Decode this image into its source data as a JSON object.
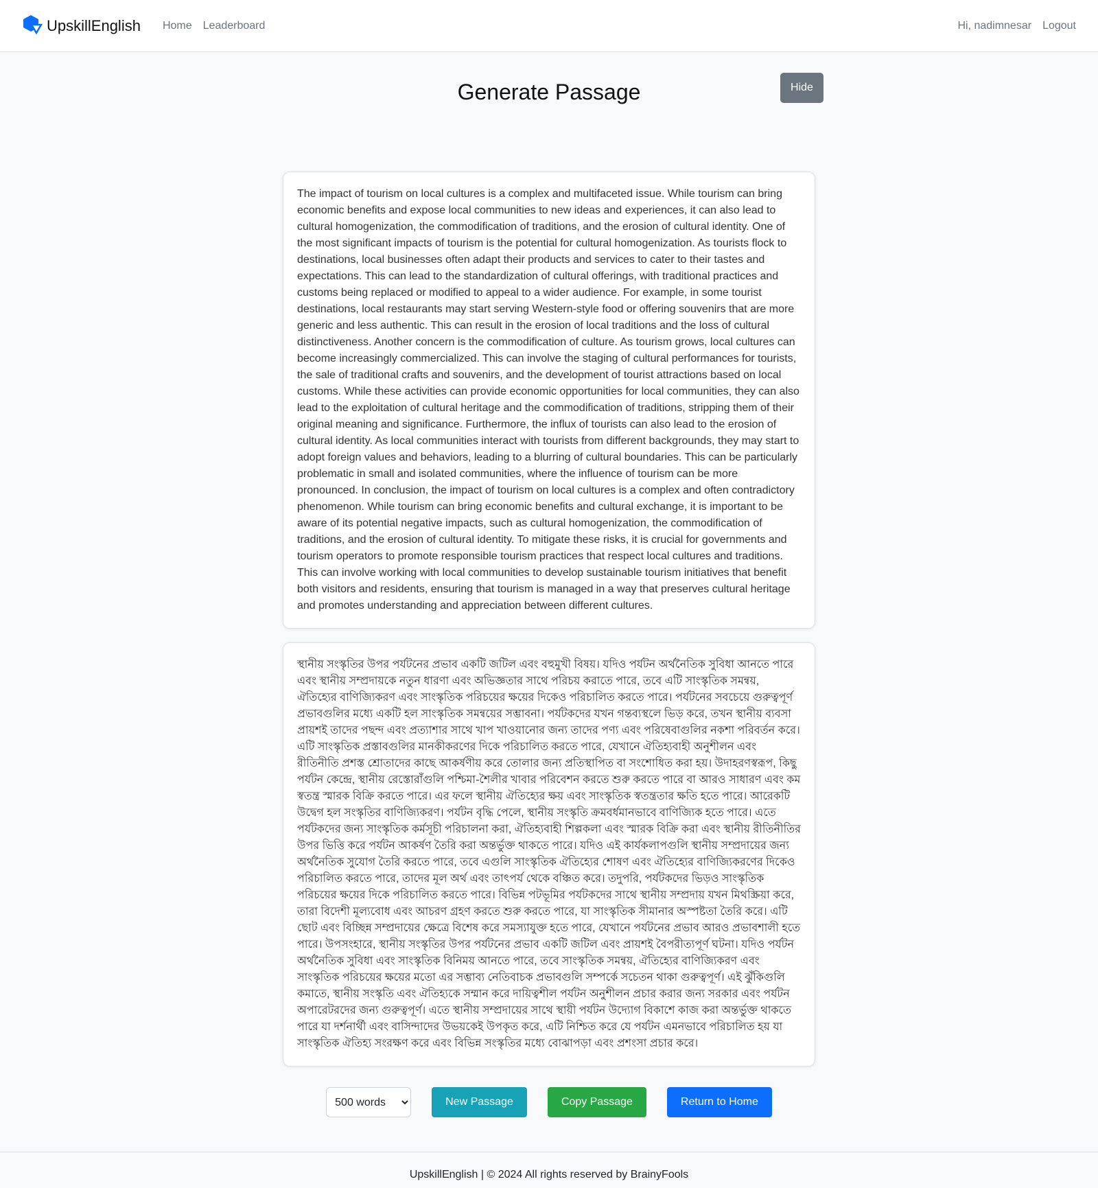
{
  "nav": {
    "brand": "UpskillEnglish",
    "links": [
      "Home",
      "Leaderboard"
    ],
    "greeting": "Hi, nadimnesar",
    "logout": "Logout"
  },
  "page": {
    "title": "Generate Passage",
    "hide_label": "Hide"
  },
  "passage": {
    "english": "The impact of tourism on local cultures is a complex and multifaceted issue. While tourism can bring economic benefits and expose local communities to new ideas and experiences, it can also lead to cultural homogenization, the commodification of traditions, and the erosion of cultural identity. One of the most significant impacts of tourism is the potential for cultural homogenization. As tourists flock to destinations, local businesses often adapt their products and services to cater to their tastes and expectations. This can lead to the standardization of cultural offerings, with traditional practices and customs being replaced or modified to appeal to a wider audience. For example, in some tourist destinations, local restaurants may start serving Western-style food or offering souvenirs that are more generic and less authentic. This can result in the erosion of local traditions and the loss of cultural distinctiveness. Another concern is the commodification of culture. As tourism grows, local cultures can become increasingly commercialized. This can involve the staging of cultural performances for tourists, the sale of traditional crafts and souvenirs, and the development of tourist attractions based on local customs. While these activities can provide economic opportunities for local communities, they can also lead to the exploitation of cultural heritage and the commodification of traditions, stripping them of their original meaning and significance. Furthermore, the influx of tourists can also lead to the erosion of cultural identity. As local communities interact with tourists from different backgrounds, they may start to adopt foreign values and behaviors, leading to a blurring of cultural boundaries. This can be particularly problematic in small and isolated communities, where the influence of tourism can be more pronounced. In conclusion, the impact of tourism on local cultures is a complex and often contradictory phenomenon. While tourism can bring economic benefits and cultural exchange, it is important to be aware of its potential negative impacts, such as cultural homogenization, the commodification of traditions, and the erosion of cultural identity. To mitigate these risks, it is crucial for governments and tourism operators to promote responsible tourism practices that respect local cultures and traditions. This can involve working with local communities to develop sustainable tourism initiatives that benefit both visitors and residents, ensuring that tourism is managed in a way that preserves cultural heritage and promotes understanding and appreciation between different cultures.",
    "bengali": "স্থানীয় সংস্কৃতির উপর পর্যটনের প্রভাব একটি জটিল এবং বহুমুখী বিষয়। যদিও পর্যটন অর্থনৈতিক সুবিধা আনতে পারে এবং স্থানীয় সম্প্রদায়কে নতুন ধারণা এবং অভিজ্ঞতার সাথে পরিচয় করাতে পারে, তবে এটি সাংস্কৃতিক সমন্বয়, ঐতিহ্যের বাণিজ্যিকরণ এবং সাংস্কৃতিক পরিচয়ের ক্ষয়ের দিকেও পরিচালিত করতে পারে। পর্যটনের সবচেয়ে গুরুত্বপূর্ণ প্রভাবগুলির মধ্যে একটি হল সাংস্কৃতিক সমন্বয়ের সম্ভাবনা। পর্যটকদের যখন গন্তব্যস্থলে ভিড় করে, তখন স্থানীয় ব্যবসা প্রায়শই তাদের পছন্দ এবং প্রত্যাশার সাথে খাপ খাওয়ানোর জন্য তাদের পণ্য এবং পরিষেবাগুলির নকশা পরিবর্তন করে। এটি সাংস্কৃতিক প্রস্তাবগুলির মানকীকরণের দিকে পরিচালিত করতে পারে, যেখানে ঐতিহ্যবাহী অনুশীলন এবং রীতিনীতি প্রশস্ত শ্রোতাদের কাছে আকর্ষণীয় করে তোলার জন্য প্রতিস্থাপিত বা সংশোধিত করা হয়। উদাহরণস্বরূপ, কিছু পর্যটন কেন্দ্রে, স্থানীয় রেস্তোরাঁগুলি পশ্চিমা-শৈলীর খাবার পরিবেশন করতে শুরু করতে পারে বা আরও সাধারণ এবং কম স্বতন্ত্র স্মারক বিক্রি করতে পারে। এর ফলে স্থানীয় ঐতিহ্যের ক্ষয় এবং সাংস্কৃতিক স্বতন্ত্রতার ক্ষতি হতে পারে। আরেকটি উদ্বেগ হল সংস্কৃতির বাণিজ্যিকরণ। পর্যটন বৃদ্ধি পেলে, স্থানীয় সংস্কৃতি ক্রমবর্ধমানভাবে বাণিজ্যিক হতে পারে। এতে পর্যটকদের জন্য সাংস্কৃতিক কর্মসূচী পরিচালনা করা, ঐতিহ্যবাহী শিল্পকলা এবং স্মারক বিক্রি করা এবং স্থানীয় রীতিনীতির উপর ভিত্তি করে পর্যটন আকর্ষণ তৈরি করা অন্তর্ভুক্ত থাকতে পারে। যদিও এই কার্যকলাপগুলি স্থানীয় সম্প্রদায়ের জন্য অর্থনৈতিক সুযোগ তৈরি করতে পারে, তবে এগুলি সাংস্কৃতিক ঐতিহ্যের শোষণ এবং ঐতিহ্যের বাণিজ্যিকরণের দিকেও পরিচালিত করতে পারে, তাদের মূল অর্থ এবং তাৎপর্য থেকে বঞ্চিত করে। তদুপরি, পর্যটকদের ভিড়ও সাংস্কৃতিক পরিচয়ের ক্ষয়ের দিকে পরিচালিত করতে পারে। বিভিন্ন পটভূমির পর্যটকদের সাথে স্থানীয় সম্প্রদায় যখন মিথস্ক্রিয়া করে, তারা বিদেশী মূল্যবোধ এবং আচরণ গ্রহণ করতে শুরু করতে পারে, যা সাংস্কৃতিক সীমানার অস্পষ্টতা তৈরি করে। এটি ছোট এবং বিচ্ছিন্ন সম্প্রদায়ের ক্ষেত্রে বিশেষ করে সমস্যাযুক্ত হতে পারে, যেখানে পর্যটনের প্রভাব আরও প্রভাবশালী হতে পারে। উপসংহারে, স্থানীয় সংস্কৃতির উপর পর্যটনের প্রভাব একটি জটিল এবং প্রায়শই বৈপরীত্যপূর্ণ ঘটনা। যদিও পর্যটন অর্থনৈতিক সুবিধা এবং সাংস্কৃতিক বিনিময় আনতে পারে, তবে সাংস্কৃতিক সমন্বয়, ঐতিহ্যের বাণিজ্যিকরণ এবং সাংস্কৃতিক পরিচয়ের ক্ষয়ের মতো এর সম্ভাব্য নেতিবাচক প্রভাবগুলি সম্পর্কে সচেতন থাকা গুরুত্বপূর্ণ। এই ঝুঁকিগুলি কমাতে, স্থানীয় সংস্কৃতি এবং ঐতিহ্যকে সম্মান করে দায়িত্বশীল পর্যটন অনুশীলন প্রচার করার জন্য সরকার এবং পর্যটন অপারেটরদের জন্য গুরুত্বপূর্ণ। এতে স্থানীয় সম্প্রদায়ের সাথে স্থায়ী পর্যটন উদ্যোগ বিকাশে কাজ করা অন্তর্ভুক্ত থাকতে পারে যা দর্শনার্থী এবং বাসিন্দাদের উভয়কেই উপকৃত করে, এটি নিশ্চিত করে যে পর্যটন এমনভাবে পরিচালিত হয় যা সাংস্কৃতিক ঐতিহ্য সংরক্ষণ করে এবং বিভিন্ন সংস্কৃতির মধ্যে বোঝাপড়া এবং প্রশংসা প্রচার করে।"
  },
  "controls": {
    "word_count_selected": "500 words",
    "new_passage": "New Passage",
    "copy_passage": "Copy Passage",
    "return_home": "Return to Home"
  },
  "footer": {
    "text": "UpskillEnglish | © 2024 All rights reserved by BrainyFools"
  },
  "colors": {
    "brand_blue": "#0d6efd",
    "info": "#17a2b8",
    "success": "#28a745",
    "secondary": "#6c757d"
  },
  "icons": {
    "logo": "upskill-logo-icon"
  }
}
